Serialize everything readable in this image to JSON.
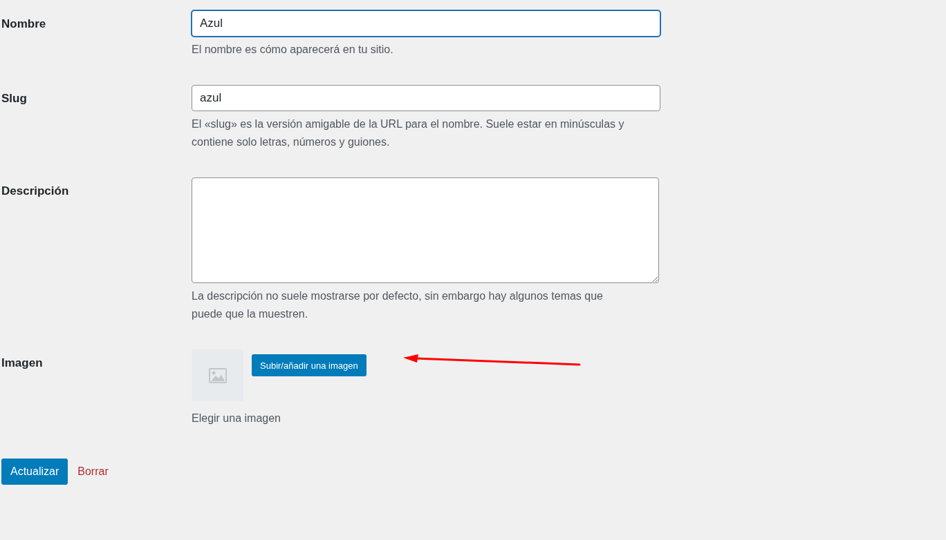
{
  "fields": [
    {
      "kind": "text",
      "label": "Nombre",
      "value": "Azul",
      "focused": true,
      "description": "El nombre es cómo aparecerá en tu sitio."
    },
    {
      "kind": "text",
      "label": "Slug",
      "value": "azul",
      "focused": false,
      "description": "El «slug» es la versión amigable de la URL para el nombre. Suele estar en minúsculas y contiene solo letras, números y guiones."
    },
    {
      "kind": "textarea",
      "label": "Descripción",
      "focused": false,
      "description": "La descripción no suele mostrarse por defecto, sin embargo hay algunos temas que puede que la muestren."
    },
    {
      "kind": "image",
      "label": "Imagen",
      "button": "Subir/añadir una imagen",
      "description": "Elegir una imagen"
    }
  ],
  "actions": {
    "submit": "Actualizar",
    "delete": "Borrar"
  }
}
